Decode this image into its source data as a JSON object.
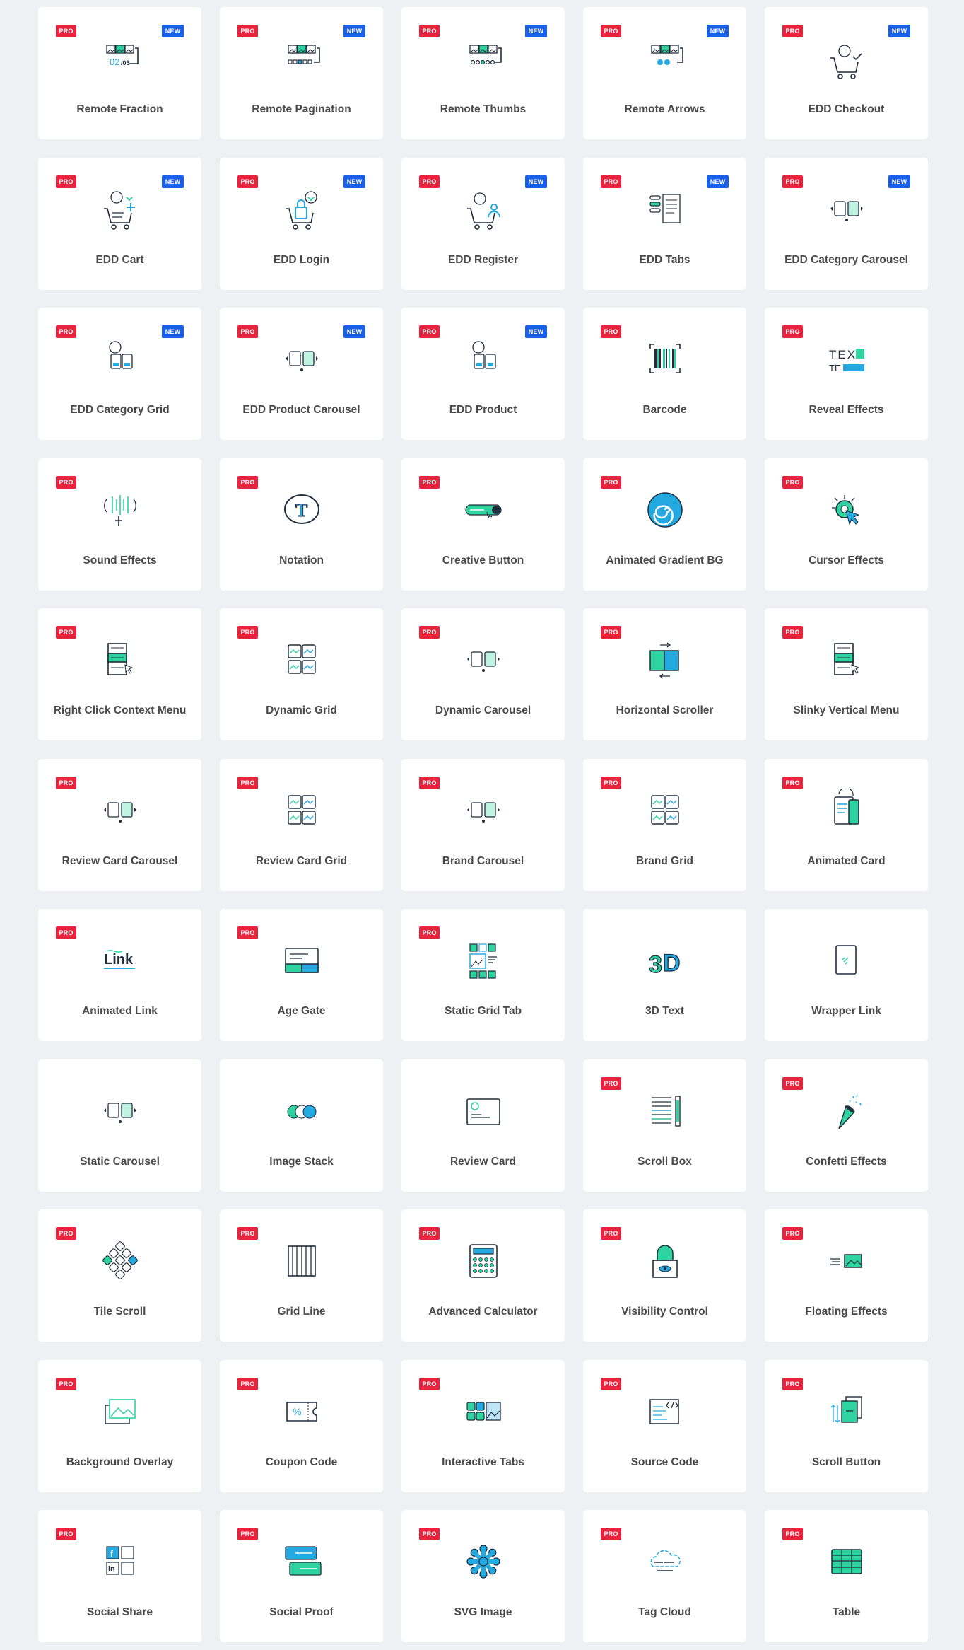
{
  "colors": {
    "background": "#eef0f3",
    "card": "#ffffff",
    "pro_badge": "#e8233e",
    "new_badge": "#1a5fe8",
    "icon_dark": "#1f2d3d",
    "icon_green": "#2ed3a0",
    "icon_blue": "#23a8e0",
    "label": "#4a4a4a"
  },
  "badges": {
    "pro": "PRO",
    "new": "NEW"
  },
  "widgets": [
    {
      "label": "Remote Fraction",
      "pro": true,
      "new": true,
      "icon": "remote-fraction",
      "fraction": "02",
      "total": "/03"
    },
    {
      "label": "Remote Pagination",
      "pro": true,
      "new": true,
      "icon": "remote-pagination"
    },
    {
      "label": "Remote Thumbs",
      "pro": true,
      "new": true,
      "icon": "remote-thumbs"
    },
    {
      "label": "Remote Arrows",
      "pro": true,
      "new": true,
      "icon": "remote-arrows"
    },
    {
      "label": "EDD Checkout",
      "pro": true,
      "new": true,
      "icon": "cart-check"
    },
    {
      "label": "EDD Cart",
      "pro": true,
      "new": true,
      "icon": "cart-plus"
    },
    {
      "label": "EDD Login",
      "pro": true,
      "new": true,
      "icon": "cart-lock"
    },
    {
      "label": "EDD Register",
      "pro": true,
      "new": true,
      "icon": "cart-user"
    },
    {
      "label": "EDD Tabs",
      "pro": true,
      "new": true,
      "icon": "tabs"
    },
    {
      "label": "EDD Category Carousel",
      "pro": true,
      "new": true,
      "icon": "carousel"
    },
    {
      "label": "EDD Category Grid",
      "pro": true,
      "new": true,
      "icon": "grid"
    },
    {
      "label": "EDD Product Carousel",
      "pro": true,
      "new": true,
      "icon": "carousel"
    },
    {
      "label": "EDD Product",
      "pro": true,
      "new": true,
      "icon": "grid"
    },
    {
      "label": "Barcode",
      "pro": true,
      "new": false,
      "icon": "barcode"
    },
    {
      "label": "Reveal Effects",
      "pro": true,
      "new": false,
      "icon": "reveal",
      "text_a": "TEX",
      "text_b": "TE"
    },
    {
      "label": "Sound Effects",
      "pro": true,
      "new": false,
      "icon": "sound"
    },
    {
      "label": "Notation",
      "pro": true,
      "new": false,
      "icon": "notation",
      "letter": "T"
    },
    {
      "label": "Creative Button",
      "pro": true,
      "new": false,
      "icon": "button"
    },
    {
      "label": "Animated Gradient BG",
      "pro": true,
      "new": false,
      "icon": "gradient"
    },
    {
      "label": "Cursor Effects",
      "pro": true,
      "new": false,
      "icon": "cursor"
    },
    {
      "label": "Right Click Context Menu",
      "pro": true,
      "new": false,
      "icon": "menu"
    },
    {
      "label": "Dynamic Grid",
      "pro": true,
      "new": false,
      "icon": "grid4"
    },
    {
      "label": "Dynamic Carousel",
      "pro": true,
      "new": false,
      "icon": "carousel"
    },
    {
      "label": "Horizontal Scroller",
      "pro": true,
      "new": false,
      "icon": "hscroll"
    },
    {
      "label": "Slinky Vertical Menu",
      "pro": true,
      "new": false,
      "icon": "menu"
    },
    {
      "label": "Review Card Carousel",
      "pro": true,
      "new": false,
      "icon": "carousel"
    },
    {
      "label": "Review Card Grid",
      "pro": true,
      "new": false,
      "icon": "grid4"
    },
    {
      "label": "Brand Carousel",
      "pro": true,
      "new": false,
      "icon": "carousel"
    },
    {
      "label": "Brand Grid",
      "pro": true,
      "new": false,
      "icon": "grid4"
    },
    {
      "label": "Animated Card",
      "pro": true,
      "new": false,
      "icon": "card"
    },
    {
      "label": "Animated Link",
      "pro": true,
      "new": false,
      "icon": "link",
      "word": "Link"
    },
    {
      "label": "Age Gate",
      "pro": true,
      "new": false,
      "icon": "agegate"
    },
    {
      "label": "Static Grid Tab",
      "pro": true,
      "new": false,
      "icon": "gridtab"
    },
    {
      "label": "3D Text",
      "pro": false,
      "new": false,
      "icon": "text3d",
      "word": "3D"
    },
    {
      "label": "Wrapper Link",
      "pro": false,
      "new": false,
      "icon": "wrapper"
    },
    {
      "label": "Static Carousel",
      "pro": false,
      "new": false,
      "icon": "carousel"
    },
    {
      "label": "Image Stack",
      "pro": false,
      "new": false,
      "icon": "stack"
    },
    {
      "label": "Review Card",
      "pro": false,
      "new": false,
      "icon": "review"
    },
    {
      "label": "Scroll Box",
      "pro": true,
      "new": false,
      "icon": "scrollbox"
    },
    {
      "label": "Confetti Effects",
      "pro": true,
      "new": false,
      "icon": "confetti"
    },
    {
      "label": "Tile Scroll",
      "pro": true,
      "new": false,
      "icon": "tiles"
    },
    {
      "label": "Grid Line",
      "pro": true,
      "new": false,
      "icon": "gridline"
    },
    {
      "label": "Advanced Calculator",
      "pro": true,
      "new": false,
      "icon": "calculator"
    },
    {
      "label": "Visibility Control",
      "pro": true,
      "new": false,
      "icon": "visibility"
    },
    {
      "label": "Floating Effects",
      "pro": true,
      "new": false,
      "icon": "floating"
    },
    {
      "label": "Background Overlay",
      "pro": true,
      "new": false,
      "icon": "overlay"
    },
    {
      "label": "Coupon Code",
      "pro": true,
      "new": false,
      "icon": "coupon"
    },
    {
      "label": "Interactive Tabs",
      "pro": true,
      "new": false,
      "icon": "itabs"
    },
    {
      "label": "Source Code",
      "pro": true,
      "new": false,
      "icon": "code"
    },
    {
      "label": "Scroll Button",
      "pro": true,
      "new": false,
      "icon": "scrollbtn"
    },
    {
      "label": "Social Share",
      "pro": true,
      "new": false,
      "icon": "social"
    },
    {
      "label": "Social Proof",
      "pro": true,
      "new": false,
      "icon": "proof"
    },
    {
      "label": "SVG Image",
      "pro": true,
      "new": false,
      "icon": "svgimage"
    },
    {
      "label": "Tag Cloud",
      "pro": true,
      "new": false,
      "icon": "cloud"
    },
    {
      "label": "Table",
      "pro": true,
      "new": false,
      "icon": "table"
    }
  ]
}
